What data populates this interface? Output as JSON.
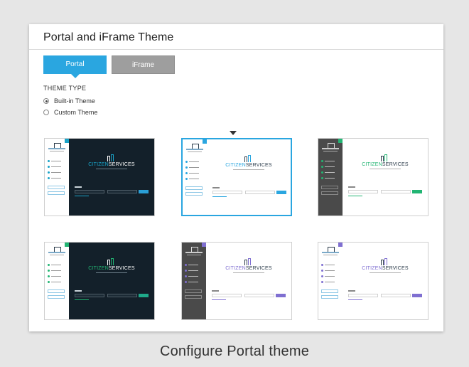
{
  "panel": {
    "title": "Portal and iFrame Theme",
    "tabs": [
      {
        "label": "Portal",
        "active": true
      },
      {
        "label": "iFrame",
        "active": false
      }
    ],
    "theme_type": {
      "label": "THEME TYPE",
      "options": [
        {
          "label": "Built-in Theme",
          "selected": true
        },
        {
          "label": "Custom Theme",
          "selected": false
        }
      ]
    }
  },
  "themes": [
    {
      "name": "dark-cyan",
      "sidebar": "#ffffff",
      "main": "#13202a",
      "accent": "#1aa3c8",
      "button": "#2a9fd6",
      "selected": false
    },
    {
      "name": "light-blue",
      "sidebar": "#ffffff",
      "main": "#ffffff",
      "accent": "#2aa6e0",
      "button": "#2aa6e0",
      "selected": true
    },
    {
      "name": "grey-green",
      "sidebar": "#4a4a4a",
      "main": "#ffffff",
      "accent": "#22b573",
      "button": "#22b573",
      "selected": false
    },
    {
      "name": "dark-green",
      "sidebar": "#ffffff",
      "main": "#13202a",
      "accent": "#22b573",
      "button": "#1faa8a",
      "selected": false
    },
    {
      "name": "grey-purple",
      "sidebar": "#4a4a4a",
      "main": "#ffffff",
      "accent": "#7f6fd1",
      "button": "#7f6fd1",
      "selected": false
    },
    {
      "name": "light-purple",
      "sidebar": "#ffffff",
      "main": "#ffffff",
      "accent": "#7f6fd1",
      "button": "#7f6fd1",
      "selected": false
    }
  ],
  "caption": "Configure Portal theme"
}
